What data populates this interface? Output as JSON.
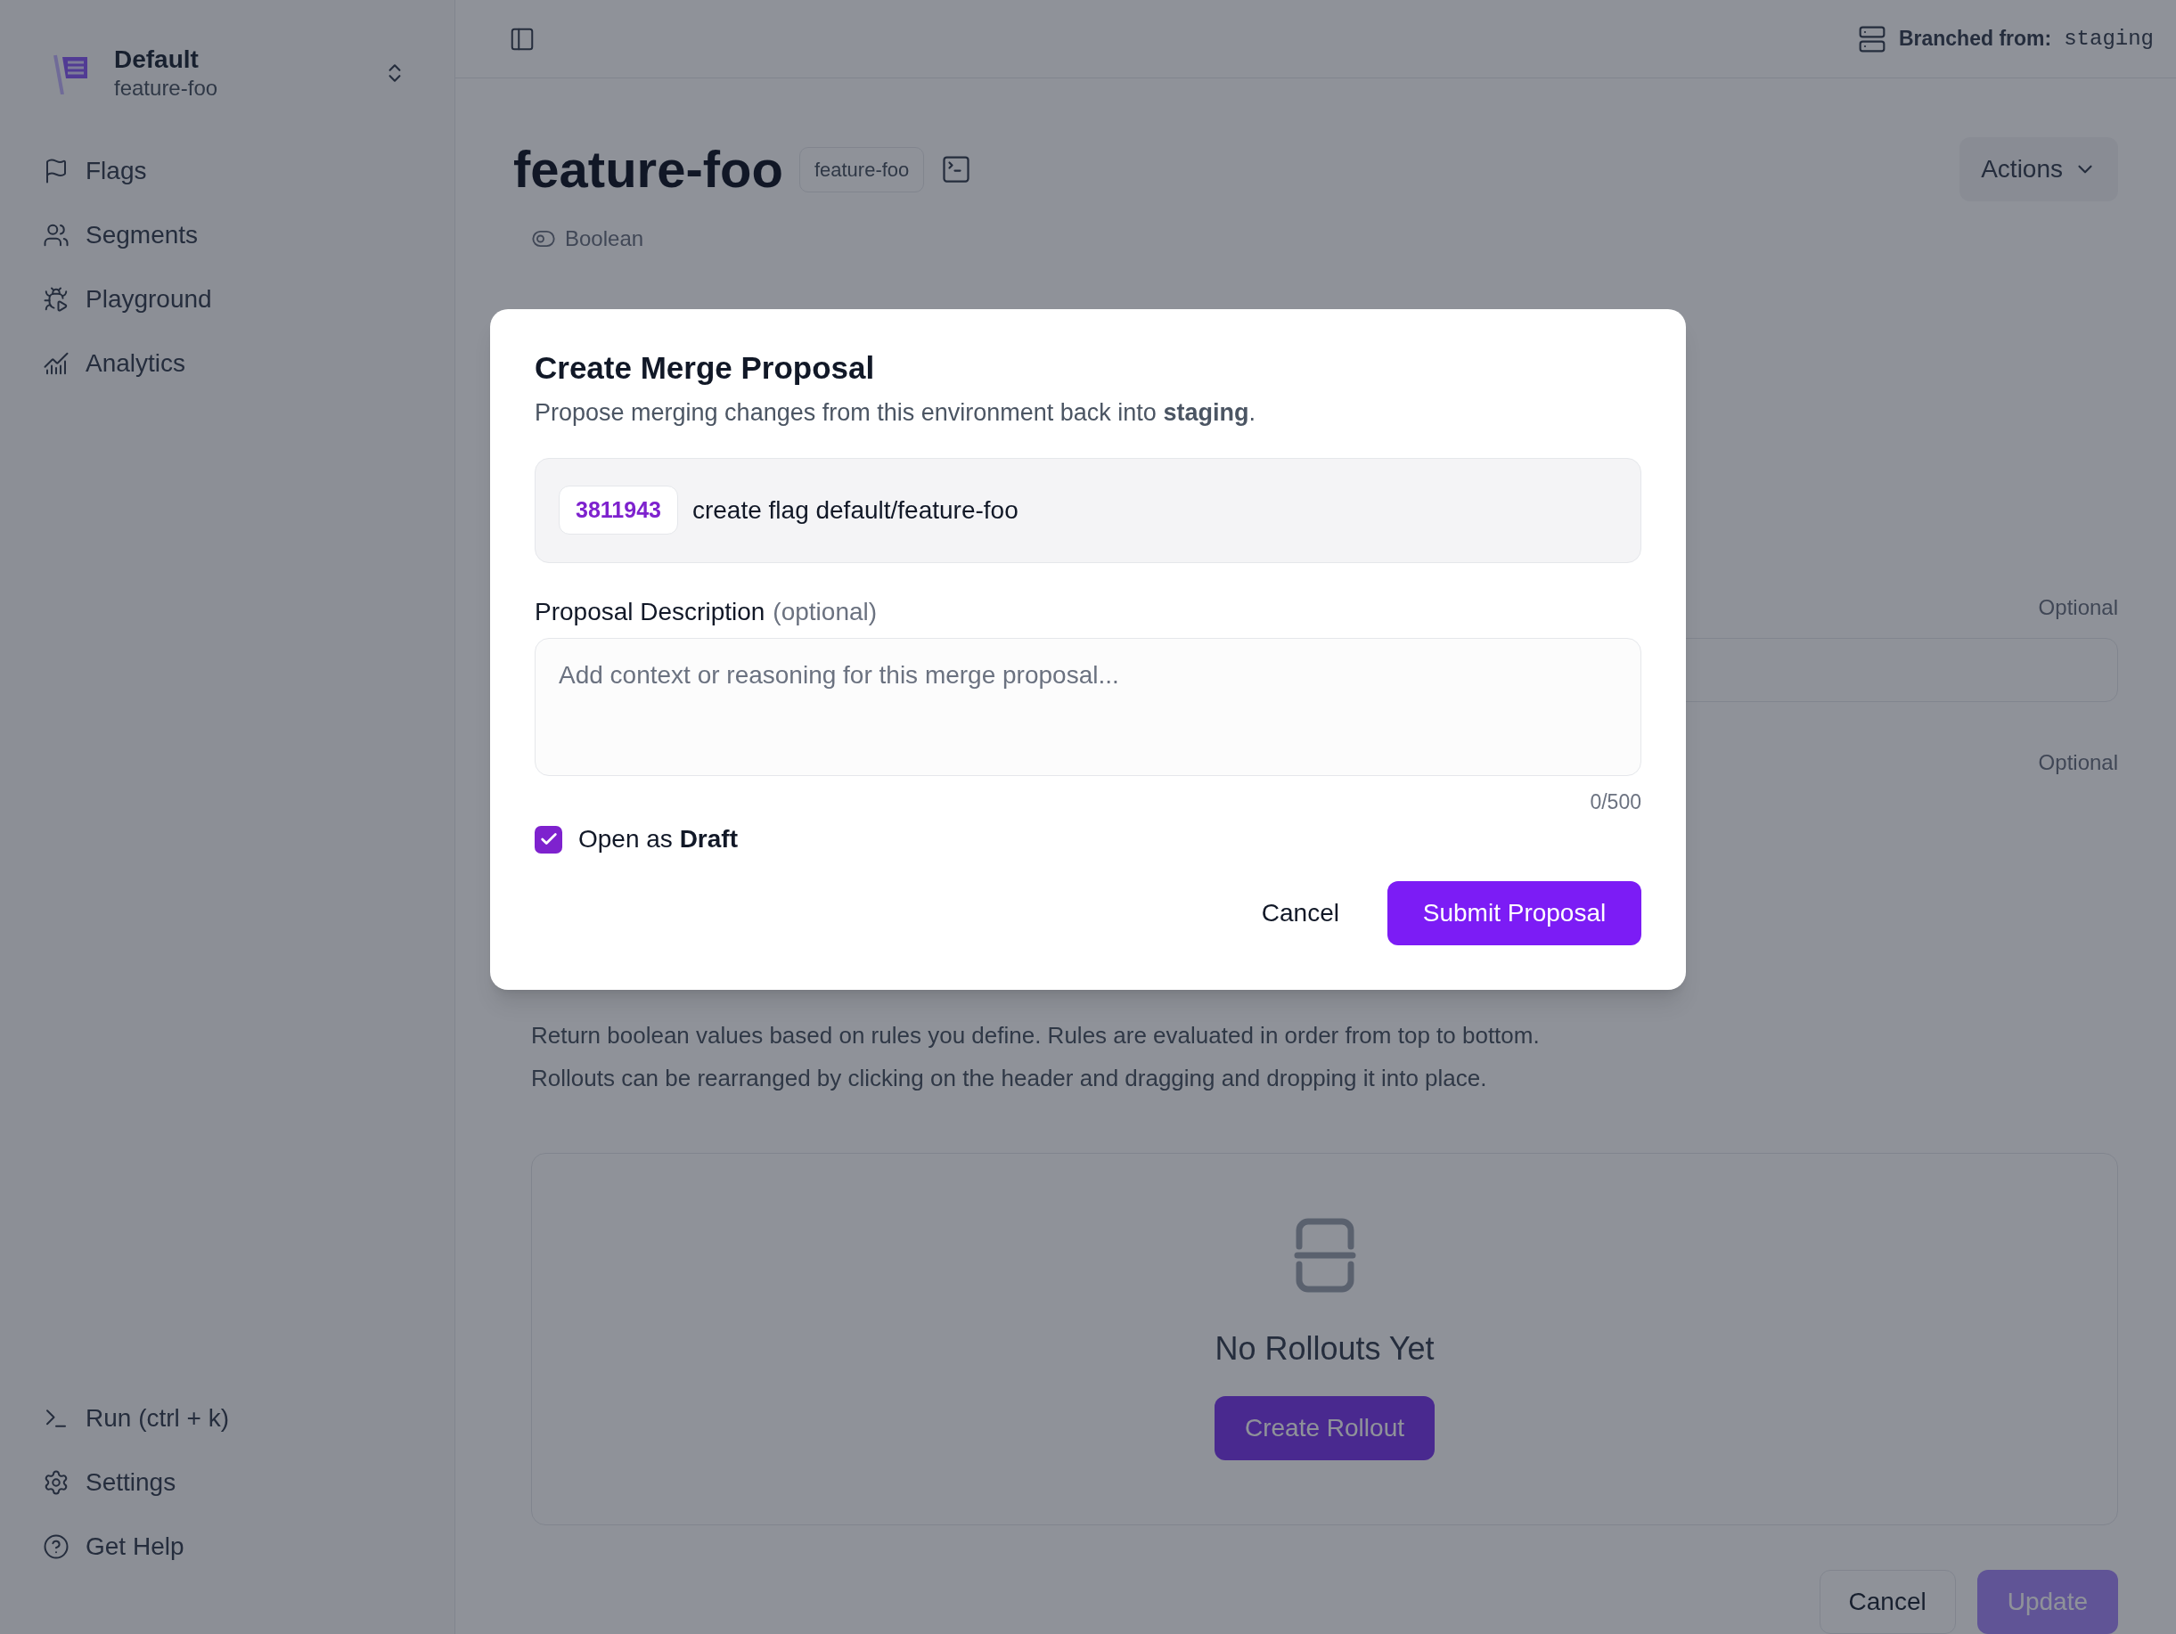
{
  "sidebar": {
    "workspace": {
      "name": "Default",
      "environment": "feature-foo"
    },
    "nav_items": [
      {
        "kind": "flag",
        "label": "Flags"
      },
      {
        "kind": "users",
        "label": "Segments"
      },
      {
        "kind": "bug",
        "label": "Playground"
      },
      {
        "kind": "chart",
        "label": "Analytics"
      }
    ],
    "footer_items": [
      {
        "kind": "terminal",
        "label": "Run (ctrl + k)"
      },
      {
        "kind": "gear",
        "label": "Settings"
      },
      {
        "kind": "help",
        "label": "Get Help"
      }
    ]
  },
  "top_bar": {
    "branch_label": "Branched from:",
    "branch": "staging"
  },
  "flag": {
    "title": "feature-foo",
    "key": "feature-foo",
    "type": "Boolean",
    "actions": "Actions"
  },
  "form": {
    "optional_labels": [
      "Optional",
      "Optional"
    ]
  },
  "rollouts": {
    "description_lines": [
      "Return boolean values based on rules you define. Rules are evaluated in order from top to bottom.",
      "Rollouts can be rearranged by clicking on the header and dragging and dropping it into place."
    ],
    "empty_title": "No Rollouts Yet",
    "create_button": "Create Rollout"
  },
  "form_buttons": {
    "cancel": "Cancel",
    "update": "Update"
  },
  "dialog": {
    "title": "Create Merge Proposal",
    "description": "Propose merging changes from this environment back into **staging**.",
    "commit": {
      "hash": "3811943",
      "message": "create flag default/feature-foo"
    },
    "field": {
      "label": "Proposal Description",
      "hint": "(optional)",
      "placeholder": "Add context or reasoning for this merge proposal...",
      "counter": "0/500"
    },
    "draft": {
      "label": "Open as **Draft**",
      "checked": true
    },
    "cancel": "Cancel",
    "submit": "Submit Proposal"
  }
}
